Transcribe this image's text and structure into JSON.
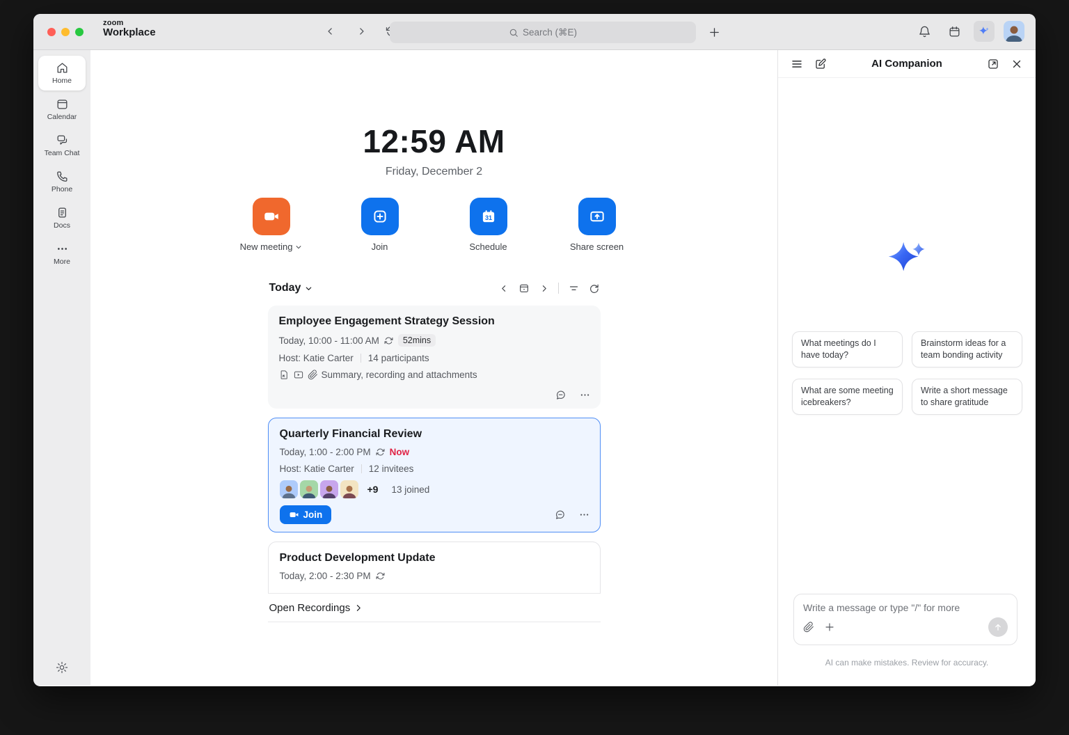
{
  "titlebar": {
    "logo_small": "zoom",
    "logo_large": "Workplace",
    "search_placeholder": "Search (⌘E)"
  },
  "sidebar": {
    "items": [
      {
        "label": "Home"
      },
      {
        "label": "Calendar"
      },
      {
        "label": "Team Chat"
      },
      {
        "label": "Phone"
      },
      {
        "label": "Docs"
      },
      {
        "label": "More"
      }
    ]
  },
  "home": {
    "clock": "12:59 AM",
    "date": "Friday, December 2",
    "actions": [
      {
        "label": "New meeting"
      },
      {
        "label": "Join"
      },
      {
        "label": "Schedule"
      },
      {
        "label": "Share screen"
      }
    ],
    "list": {
      "filter": "Today",
      "footer": "Open Recordings"
    },
    "meetings": [
      {
        "title": "Employee Engagement Strategy Session",
        "time": "Today, 10:00 - 11:00 AM",
        "duration_badge": "52mins",
        "host": "Host: Katie Carter",
        "participants": "14 participants",
        "attachments": "Summary, recording and attachments"
      },
      {
        "title": "Quarterly Financial Review",
        "time": "Today, 1:00 - 2:00 PM",
        "status": "Now",
        "host": "Host: Katie Carter",
        "participants": "12 invitees",
        "overflow": "+9",
        "joined": "13 joined",
        "join_label": "Join"
      },
      {
        "title": "Product Development Update",
        "time": "Today, 2:00 - 2:30 PM"
      }
    ]
  },
  "ai_panel": {
    "title": "AI Companion",
    "suggestions": [
      "What meetings do I have today?",
      "Brainstorm ideas for a team bonding activity",
      "What are some meeting icebreakers?",
      "Write a short message to share gratitude"
    ],
    "input_placeholder": "Write a message or type \"/\" for more",
    "disclaimer": "AI can make mistakes. Review for accuracy."
  },
  "icons": {
    "brand_sparkle": "ai-companion-sparkle",
    "recurring": "cycle-arrows",
    "gear": "settings-gear"
  },
  "colors": {
    "accent_blue": "#0e72ed",
    "accent_orange": "#f0682d",
    "now_red": "#e02446",
    "active_card_border": "#4e8df5",
    "active_card_bg": "#eff5ff",
    "titlebar_bg": "#e8e8e9",
    "sidebar_bg": "#ededee",
    "avatar_tiles": [
      "#aecbfa",
      "#a5d7a7",
      "#c7a6ec",
      "#f3e4c2"
    ]
  }
}
